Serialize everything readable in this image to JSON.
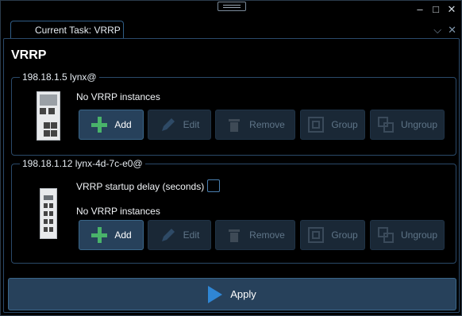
{
  "window": {
    "maximize_icon": "□",
    "close_icon": "✕",
    "minimize_icon": "–"
  },
  "tab": {
    "label": "Current Task: VRRP",
    "chevron_icon": "⌵",
    "close_icon": "✕"
  },
  "page": {
    "title": "VRRP"
  },
  "devices": [
    {
      "header": "198.18.1.5 lynx@",
      "status": "No VRRP instances",
      "buttons": {
        "add": "Add",
        "edit": "Edit",
        "remove": "Remove",
        "group": "Group",
        "ungroup": "Ungroup"
      }
    },
    {
      "header": "198.18.1.12 lynx-4d-7c-e0@",
      "startup_delay_label": "VRRP startup delay (seconds)",
      "startup_delay_checked": false,
      "status": "No VRRP instances",
      "buttons": {
        "add": "Add",
        "edit": "Edit",
        "remove": "Remove",
        "group": "Group",
        "ungroup": "Ungroup"
      }
    }
  ],
  "apply": {
    "label": "Apply"
  },
  "colors": {
    "accent": "#2f86d4",
    "add_green": "#49b36a",
    "panel_border": "#2a4a6a",
    "button_active": "#27415b"
  }
}
